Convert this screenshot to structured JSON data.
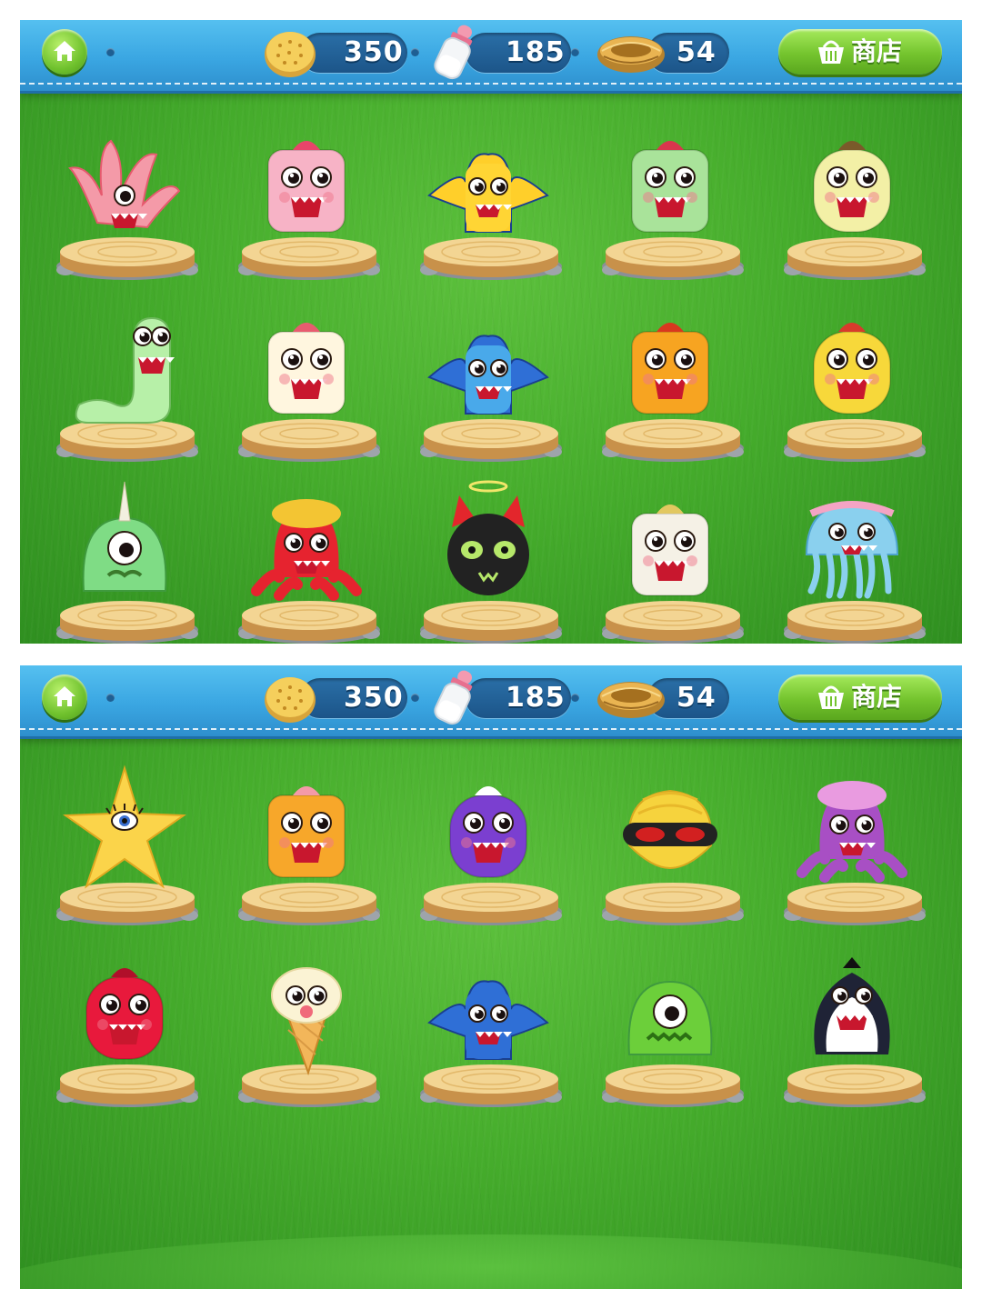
{
  "screens": [
    {
      "topbar": {
        "resources": [
          {
            "icon": "cookie-icon",
            "value": "350"
          },
          {
            "icon": "milk-bottle-icon",
            "value": "185"
          },
          {
            "icon": "nest-icon",
            "value": "54"
          }
        ],
        "shop_label": "商店"
      },
      "pets": [
        {
          "name": "pink-tentacle-monster",
          "body": "#f49aa8",
          "accent": "#e65a6e"
        },
        {
          "name": "pink-boot-monster",
          "body": "#f7b3c6",
          "accent": "#e8446a"
        },
        {
          "name": "yellow-winged-monster",
          "body": "#ffd534",
          "accent": "#f0a100"
        },
        {
          "name": "green-jelly-devil-monster",
          "body": "#a9e39a",
          "accent": "#d9364d"
        },
        {
          "name": "fluffy-sheep-king-monster",
          "body": "#f3f0a6",
          "accent": "#7a5a2a"
        },
        {
          "name": "green-worm-monster",
          "body": "#b7f0a8",
          "accent": "#e8445e"
        },
        {
          "name": "baby-bottle-monster",
          "body": "#fff6df",
          "accent": "#e85c6f"
        },
        {
          "name": "blue-unicorn-bat-monster",
          "body": "#49a9ea",
          "accent": "#f3c12e"
        },
        {
          "name": "orange-box-monster",
          "body": "#f7a421",
          "accent": "#d8371f"
        },
        {
          "name": "yellow-pirate-monster",
          "body": "#f7d83a",
          "accent": "#d73b2c"
        },
        {
          "name": "green-cyclops-horn-monster",
          "body": "#7fdc85",
          "accent": "#f2f0e0"
        },
        {
          "name": "red-octopus-monster",
          "body": "#e6232f",
          "accent": "#f3c533"
        },
        {
          "name": "black-cat-devil-monster",
          "body": "#222222",
          "accent": "#e3262c"
        },
        {
          "name": "mummy-monster",
          "body": "#f5f1e6",
          "accent": "#e2c860"
        },
        {
          "name": "blue-jellyfish-monster",
          "body": "#8ad0ee",
          "accent": "#f4a4c4"
        }
      ]
    },
    {
      "topbar": {
        "resources": [
          {
            "icon": "cookie-icon",
            "value": "350"
          },
          {
            "icon": "milk-bottle-icon",
            "value": "185"
          },
          {
            "icon": "nest-icon",
            "value": "54"
          }
        ],
        "shop_label": "商店"
      },
      "pets": [
        {
          "name": "starfish-monster",
          "body": "#fbd44a",
          "accent": "#5a3a10"
        },
        {
          "name": "orange-shell-monster",
          "body": "#f7a72a",
          "accent": "#f49aa8"
        },
        {
          "name": "purple-dragon-monster",
          "body": "#7b3fd0",
          "accent": "#ffffff"
        },
        {
          "name": "clam-sunglasses-monster",
          "body": "#f6d33d",
          "accent": "#d22020"
        },
        {
          "name": "purple-crab-monster",
          "body": "#a84fc4",
          "accent": "#e99be0"
        },
        {
          "name": "red-jelly-monster",
          "body": "#e8193c",
          "accent": "#b00f2a"
        },
        {
          "name": "ice-cream-cone-monster",
          "body": "#f7c77a",
          "accent": "#fbf3d4"
        },
        {
          "name": "blue-chef-bat-monster",
          "body": "#2f6fd6",
          "accent": "#ffe34a"
        },
        {
          "name": "green-cyclops-blob-monster",
          "body": "#6ccf3a",
          "accent": "#2c7014"
        },
        {
          "name": "penguin-monster",
          "body": "#1f2336",
          "accent": "#ffffff"
        }
      ]
    }
  ]
}
